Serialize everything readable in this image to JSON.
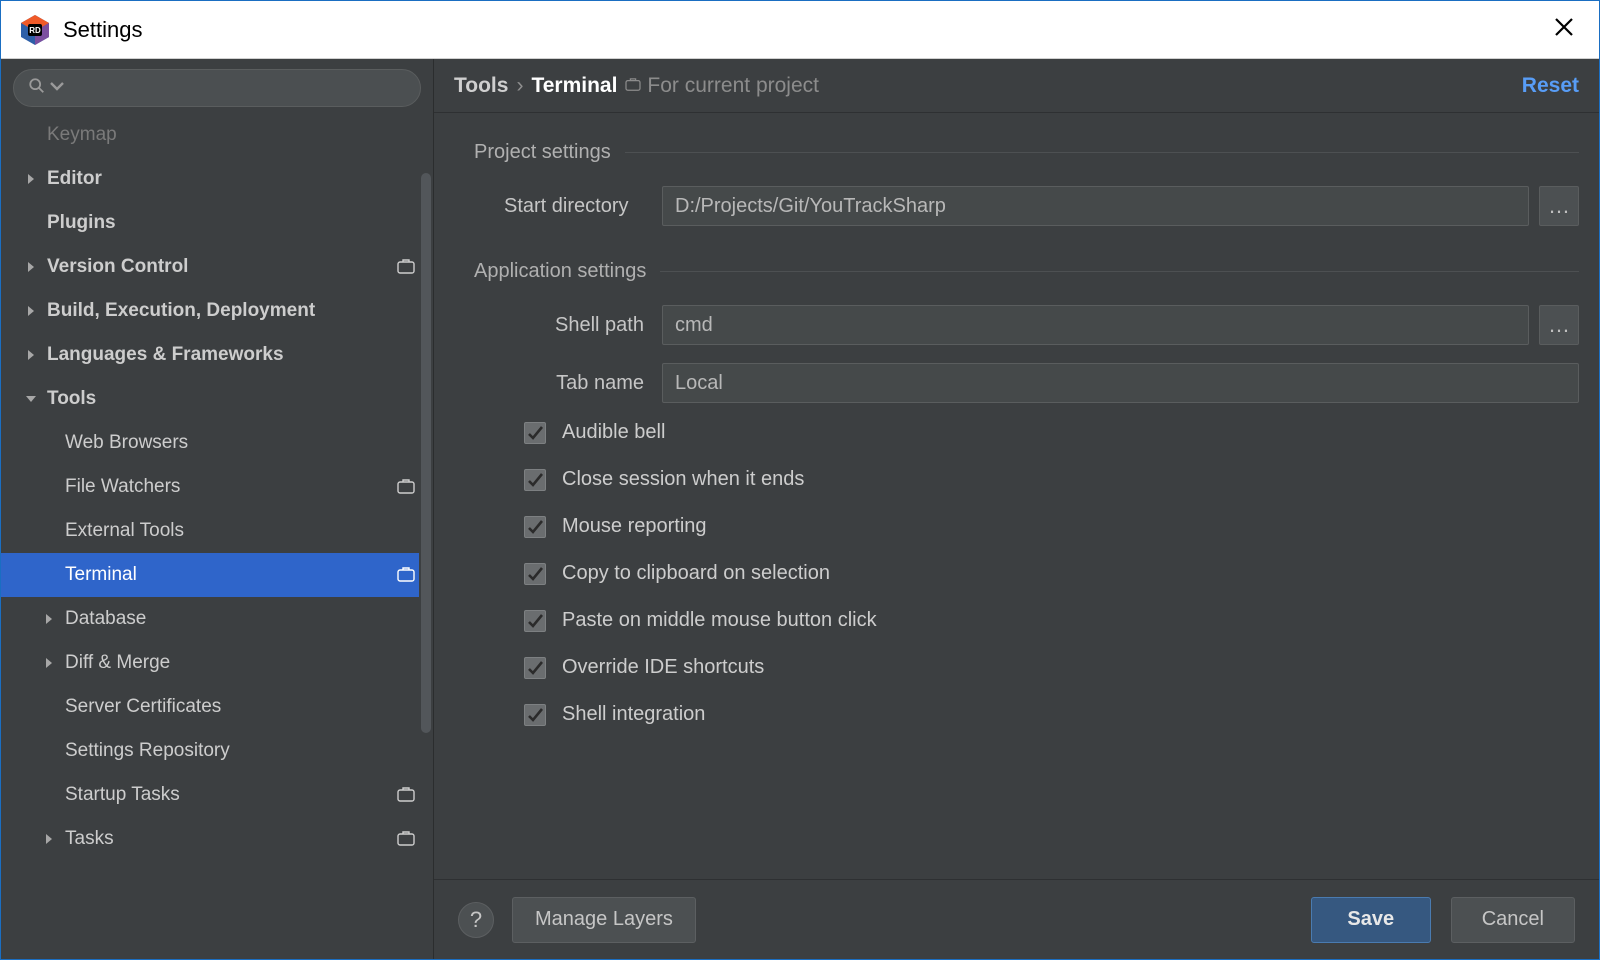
{
  "window": {
    "title": "Settings"
  },
  "sidebar": {
    "items": [
      {
        "label": "Keymap",
        "arrow": "blank",
        "bold": false,
        "cut": true,
        "proj": false
      },
      {
        "label": "Editor",
        "arrow": "right",
        "bold": true,
        "proj": false
      },
      {
        "label": "Plugins",
        "arrow": "blank",
        "bold": true,
        "proj": false
      },
      {
        "label": "Version Control",
        "arrow": "right",
        "bold": true,
        "proj": true
      },
      {
        "label": "Build, Execution, Deployment",
        "arrow": "right",
        "bold": true,
        "proj": false
      },
      {
        "label": "Languages & Frameworks",
        "arrow": "right",
        "bold": true,
        "proj": false
      },
      {
        "label": "Tools",
        "arrow": "down",
        "bold": true,
        "proj": false
      },
      {
        "label": "Web Browsers",
        "arrow": "blank",
        "child": true,
        "proj": false
      },
      {
        "label": "File Watchers",
        "arrow": "blank",
        "child": true,
        "proj": true
      },
      {
        "label": "External Tools",
        "arrow": "blank",
        "child": true,
        "proj": false
      },
      {
        "label": "Terminal",
        "arrow": "blank",
        "child": true,
        "selected": true,
        "proj": true
      },
      {
        "label": "Database",
        "arrow": "right",
        "child": true,
        "proj": false
      },
      {
        "label": "Diff & Merge",
        "arrow": "right",
        "child": true,
        "proj": false
      },
      {
        "label": "Server Certificates",
        "arrow": "blank",
        "child": true,
        "proj": false
      },
      {
        "label": "Settings Repository",
        "arrow": "blank",
        "child": true,
        "proj": false
      },
      {
        "label": "Startup Tasks",
        "arrow": "blank",
        "child": true,
        "proj": true
      },
      {
        "label": "Tasks",
        "arrow": "right",
        "child": true,
        "proj": true
      }
    ]
  },
  "header": {
    "crumb1": "Tools",
    "crumb2": "Terminal",
    "hint": "For current project",
    "reset": "Reset"
  },
  "sections": {
    "project": {
      "title": "Project settings",
      "start_dir_label": "Start directory",
      "start_dir_value": "D:/Projects/Git/YouTrackSharp"
    },
    "app": {
      "title": "Application settings",
      "shell_path_label": "Shell path",
      "shell_path_value": "cmd",
      "tab_name_label": "Tab name",
      "tab_name_value": "Local",
      "checks": [
        "Audible bell",
        "Close session when it ends",
        "Mouse reporting",
        "Copy to clipboard on selection",
        "Paste on middle mouse button click",
        "Override IDE shortcuts",
        "Shell integration"
      ]
    }
  },
  "footer": {
    "help": "?",
    "manage": "Manage Layers",
    "save": "Save",
    "cancel": "Cancel"
  }
}
